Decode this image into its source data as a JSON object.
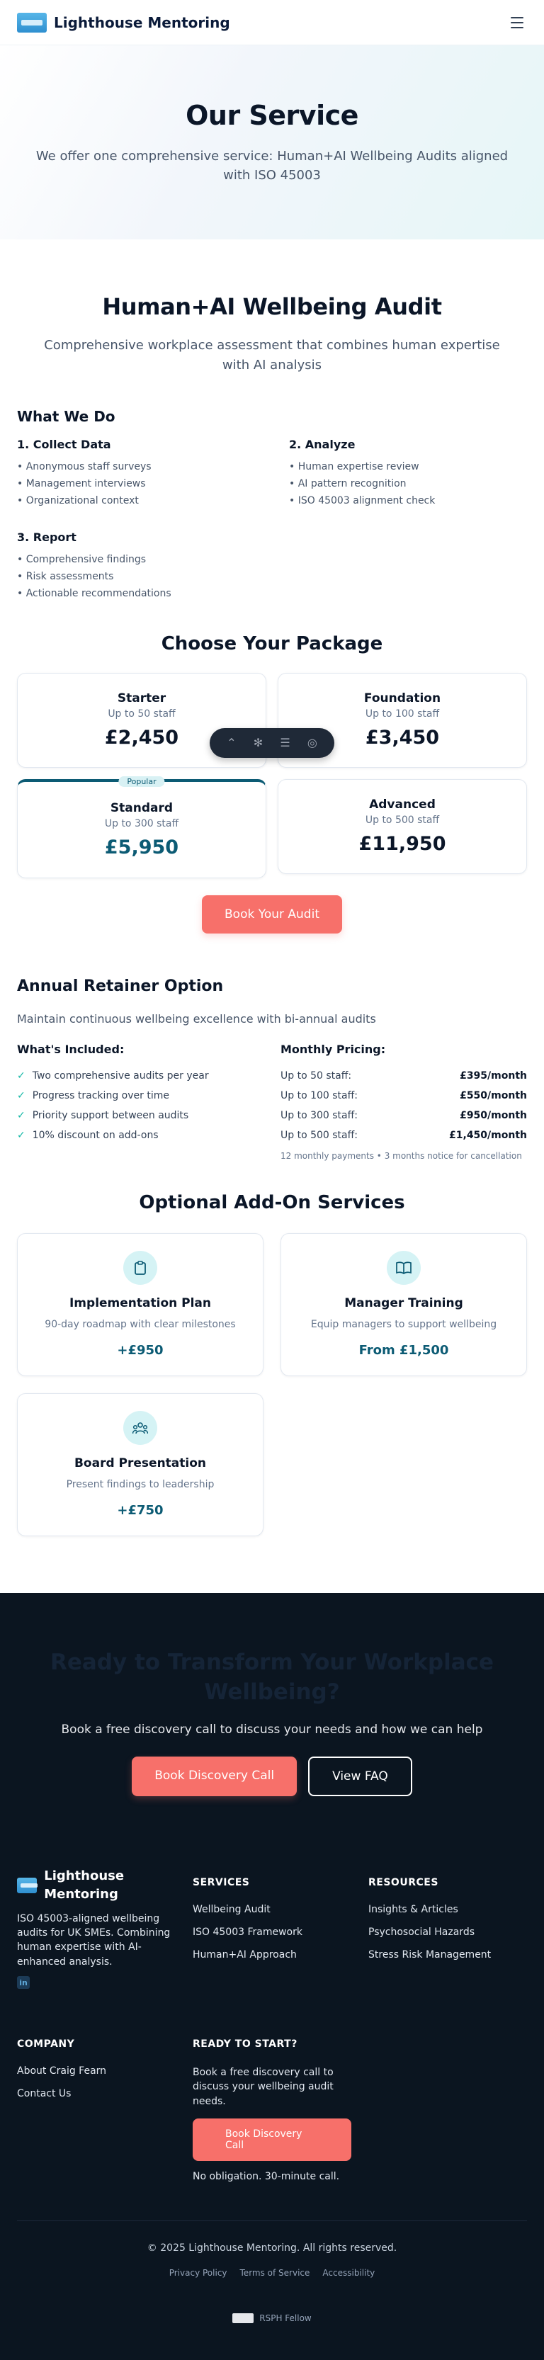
{
  "header": {
    "brand": "Lighthouse Mentoring",
    "menu_icon": "hamburger-icon"
  },
  "hero": {
    "title": "Our Service",
    "subtitle": "We offer one comprehensive service: Human+AI Wellbeing Audits aligned with ISO 45003"
  },
  "audit": {
    "title": "Human+AI Wellbeing Audit",
    "lead": "Comprehensive workplace assessment that combines human expertise with AI analysis",
    "what_we_do": "What We Do",
    "steps": [
      {
        "title": "1. Collect Data",
        "items": [
          "Anonymous staff surveys",
          "Management interviews",
          "Organizational context"
        ]
      },
      {
        "title": "2. Analyze",
        "items": [
          "Human expertise review",
          "AI pattern recognition",
          "ISO 45003 alignment check"
        ]
      },
      {
        "title": "3. Report",
        "items": [
          "Comprehensive findings",
          "Risk assessments",
          "Actionable recommendations"
        ]
      }
    ]
  },
  "packages": {
    "title": "Choose Your Package",
    "items": [
      {
        "name": "Starter",
        "size": "Up to 50 staff",
        "price": "£2,450"
      },
      {
        "name": "Foundation",
        "size": "Up to 100 staff",
        "price": "£3,450"
      },
      {
        "name": "Standard",
        "size": "Up to 300 staff",
        "price": "£5,950",
        "badge": "Popular"
      },
      {
        "name": "Advanced",
        "size": "Up to 500 staff",
        "price": "£11,950"
      }
    ],
    "cta": "Book Your Audit"
  },
  "retainer": {
    "title": "Annual Retainer Option",
    "desc": "Maintain continuous wellbeing excellence with bi-annual audits",
    "included_title": "What's Included:",
    "included": [
      "Two comprehensive audits per year",
      "Progress tracking over time",
      "Priority support between audits",
      "10% discount on add-ons"
    ],
    "pricing_title": "Monthly Pricing:",
    "pricing": [
      {
        "label": "Up to 50 staff:",
        "price": "£395/month"
      },
      {
        "label": "Up to 100 staff:",
        "price": "£550/month"
      },
      {
        "label": "Up to 300 staff:",
        "price": "£950/month"
      },
      {
        "label": "Up to 500 staff:",
        "price": "£1,450/month"
      }
    ],
    "note": "12 monthly payments • 3 months notice for cancellation"
  },
  "addons": {
    "title": "Optional Add-On Services",
    "items": [
      {
        "title": "Implementation Plan",
        "desc": "90-day roadmap with clear milestones",
        "price": "+£950",
        "icon": "clipboard-icon"
      },
      {
        "title": "Manager Training",
        "desc": "Equip managers to support wellbeing",
        "price": "From £1,500",
        "icon": "book-icon"
      },
      {
        "title": "Board Presentation",
        "desc": "Present findings to leadership",
        "price": "+£750",
        "icon": "people-icon"
      }
    ]
  },
  "cta": {
    "title": "Ready to Transform Your Workplace Wellbeing?",
    "desc": "Book a free discovery call to discuss your needs and how we can help",
    "primary": "Book Discovery Call",
    "secondary": "View FAQ"
  },
  "footer": {
    "brand": "Lighthouse Mentoring",
    "desc": "ISO 45003-aligned wellbeing audits for UK SMEs. Combining human expertise with AI-enhanced analysis.",
    "services_title": "SERVICES",
    "services": [
      "Wellbeing Audit",
      "ISO 45003 Framework",
      "Human+AI Approach"
    ],
    "resources_title": "RESOURCES",
    "resources": [
      "Insights & Articles",
      "Psychosocial Hazards",
      "Stress Risk Management"
    ],
    "company_title": "COMPANY",
    "company": [
      "About Craig Fearn",
      "Contact Us"
    ],
    "ready_title": "READY TO START?",
    "ready_desc": "Book a free discovery call to discuss your wellbeing audit needs.",
    "ready_button": "Book Discovery Call",
    "ready_note": "No obligation. 30-minute call.",
    "copyright": "© 2025 Lighthouse Mentoring. All rights reserved.",
    "legal": [
      "Privacy Policy",
      "Terms of Service",
      "Accessibility"
    ],
    "badge": "RSPH Fellow"
  },
  "colors": {
    "accent": "#0c5b74",
    "coral": "#f7706a",
    "dark_bg": "#0b1520",
    "check": "#14b8a6"
  }
}
